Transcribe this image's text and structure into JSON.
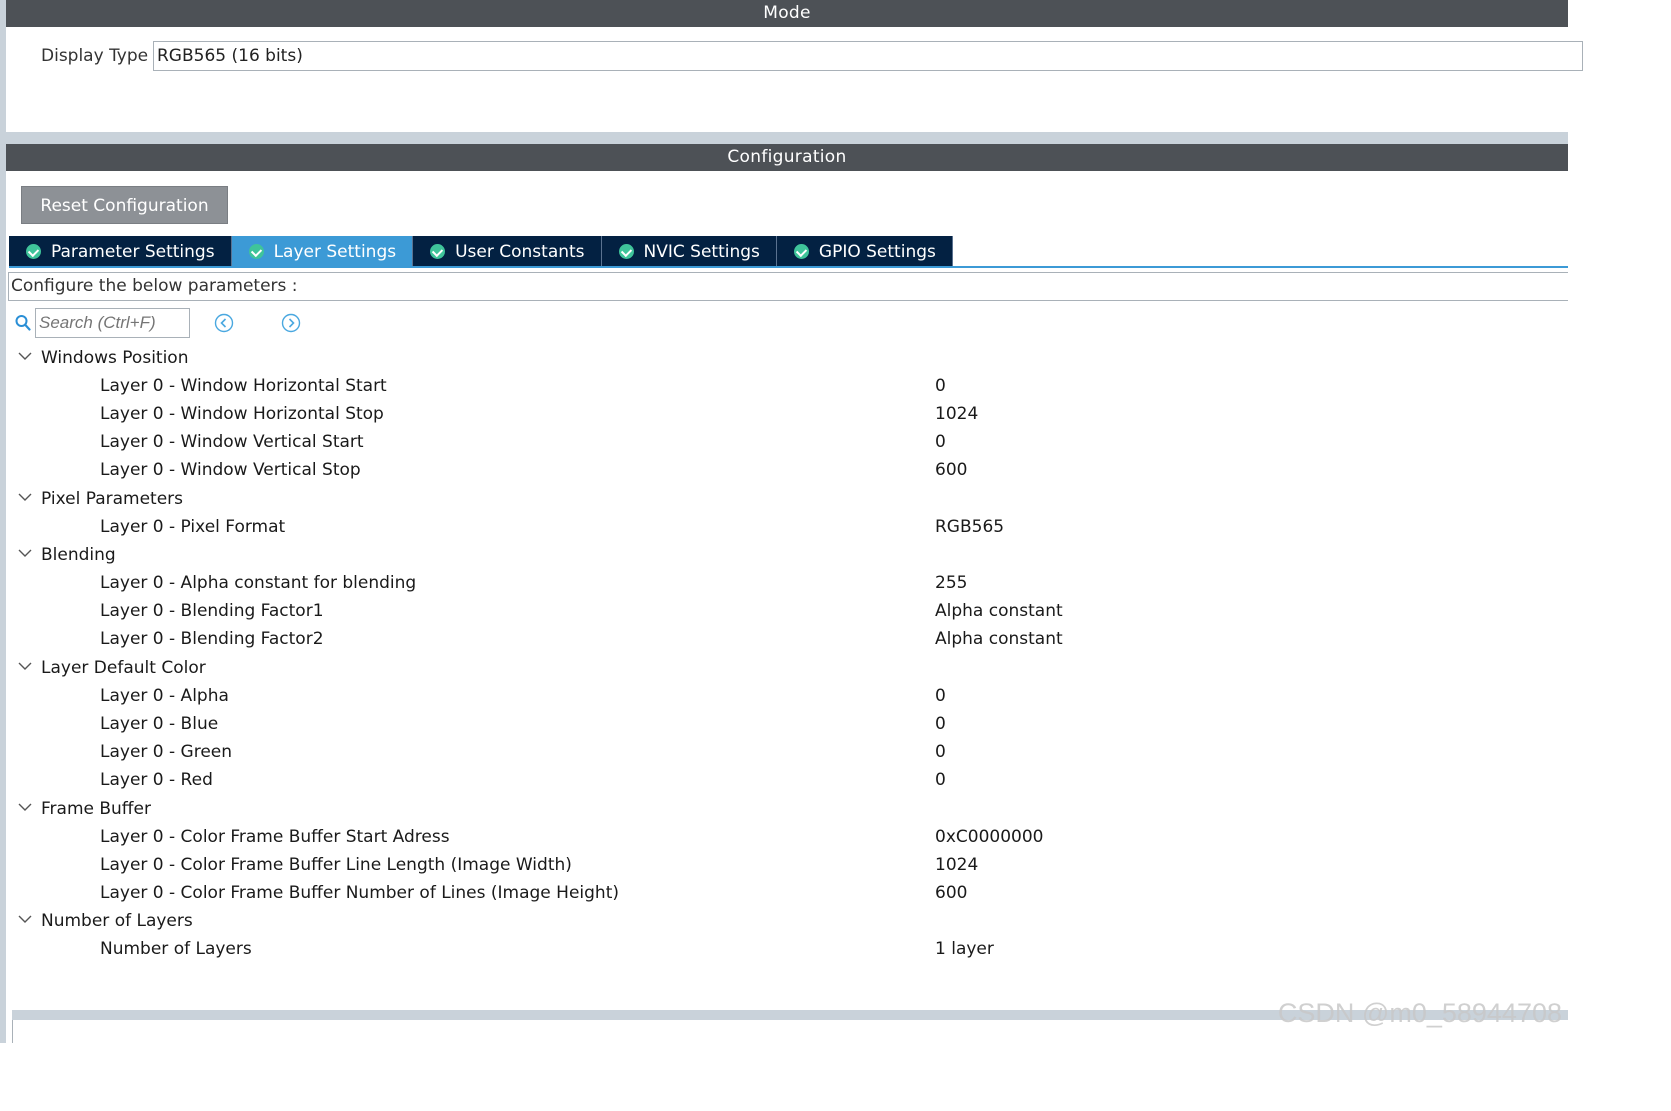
{
  "mode": {
    "header": "Mode",
    "display_type_label": "Display Type",
    "display_type_value": "RGB565 (16 bits)"
  },
  "configuration": {
    "header": "Configuration",
    "reset_button": "Reset Configuration",
    "tabs": [
      {
        "label": "Parameter Settings",
        "active": false
      },
      {
        "label": "Layer Settings",
        "active": true
      },
      {
        "label": "User Constants",
        "active": false
      },
      {
        "label": "NVIC Settings",
        "active": false
      },
      {
        "label": "GPIO Settings",
        "active": false
      }
    ],
    "configure_text": "Configure the below parameters :",
    "search_placeholder": "Search (Ctrl+F)"
  },
  "groups": [
    {
      "title": "Windows Position",
      "params": [
        {
          "label": "Layer 0 - Window Horizontal Start",
          "value": "0"
        },
        {
          "label": "Layer 0 - Window Horizontal Stop",
          "value": "1024"
        },
        {
          "label": "Layer 0 - Window Vertical Start",
          "value": "0"
        },
        {
          "label": "Layer 0 - Window Vertical Stop",
          "value": "600"
        }
      ]
    },
    {
      "title": "Pixel Parameters",
      "params": [
        {
          "label": "Layer 0 - Pixel Format",
          "value": "RGB565"
        }
      ]
    },
    {
      "title": "Blending",
      "params": [
        {
          "label": "Layer 0 - Alpha constant for blending",
          "value": "255"
        },
        {
          "label": "Layer 0 - Blending Factor1",
          "value": "Alpha constant"
        },
        {
          "label": "Layer 0 - Blending Factor2",
          "value": "Alpha constant"
        }
      ]
    },
    {
      "title": "Layer Default Color",
      "params": [
        {
          "label": "Layer 0 - Alpha",
          "value": "0"
        },
        {
          "label": "Layer 0 - Blue",
          "value": "0"
        },
        {
          "label": "Layer 0 - Green",
          "value": "0"
        },
        {
          "label": "Layer 0 - Red",
          "value": "0"
        }
      ]
    },
    {
      "title": "Frame Buffer",
      "params": [
        {
          "label": "Layer 0 - Color Frame Buffer Start Adress",
          "value": "0xC0000000"
        },
        {
          "label": "Layer 0 - Color Frame Buffer Line Length (Image Width)",
          "value": "1024"
        },
        {
          "label": "Layer 0 - Color Frame Buffer Number of Lines (Image Height)",
          "value": "600"
        }
      ]
    },
    {
      "title": "Number of Layers",
      "params": [
        {
          "label": "Number of Layers",
          "value": "1 layer"
        }
      ]
    }
  ],
  "watermark": "CSDN @m0_58944708",
  "colors": {
    "header_bg": "#4d5156",
    "tab_bg": "#032142",
    "tab_active_bg": "#3c9ad6",
    "check_green": "#3fc49a",
    "button_bg": "#8d9196"
  }
}
